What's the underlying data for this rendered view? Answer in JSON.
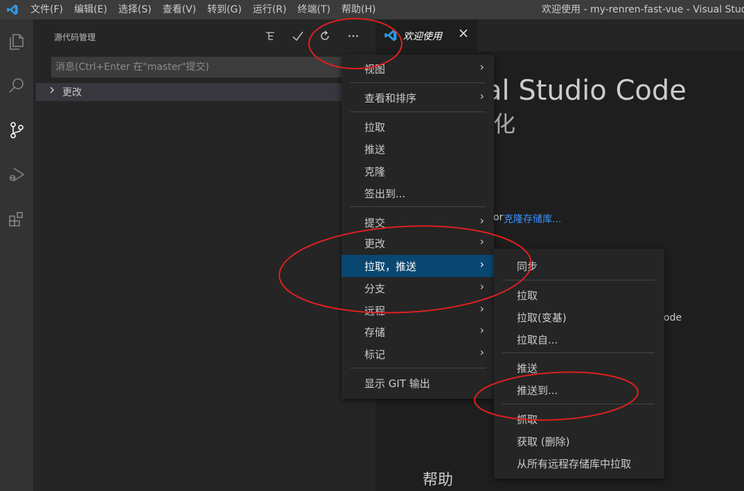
{
  "titlebar": {
    "menu": [
      "文件(F)",
      "编辑(E)",
      "选择(S)",
      "查看(V)",
      "转到(G)",
      "运行(R)",
      "终端(T)",
      "帮助(H)"
    ],
    "window_title": "欢迎使用 - my-renren-fast-vue - Visual Studio Code"
  },
  "sidebar": {
    "title": "源代码管理",
    "message_placeholder": "消息(Ctrl+Enter 在\"master\"提交)",
    "changes_label": "更改"
  },
  "editor": {
    "tab_label": "欢迎使用",
    "welcome_title": "al Studio Code",
    "welcome_subtitle": "化",
    "or_text": "or",
    "clone_link": "克隆存储库...",
    "code_text": "ode",
    "help_heading": "帮助"
  },
  "main_menu": {
    "items": {
      "view": "视图",
      "sort": "查看和排序",
      "pull": "拉取",
      "push": "推送",
      "clone": "克隆",
      "checkout": "签出到...",
      "commit": "提交",
      "changes": "更改",
      "pull_push": "拉取，推送",
      "branch": "分支",
      "remote": "远程",
      "stash": "存储",
      "tags": "标记",
      "show_git_output": "显示 GIT 输出"
    }
  },
  "sub_menu": {
    "items": {
      "sync": "同步",
      "pull": "拉取",
      "pull_rebase": "拉取(变基)",
      "pull_from": "拉取自...",
      "push": "推送",
      "push_to": "推送到...",
      "fetch": "抓取",
      "fetch_prune": "获取 (删除)",
      "pull_all": "从所有远程存储库中拉取"
    }
  },
  "colors": {
    "accent_blue": "#007acc",
    "highlight": "#094771",
    "annotation_red": "#e02020"
  }
}
